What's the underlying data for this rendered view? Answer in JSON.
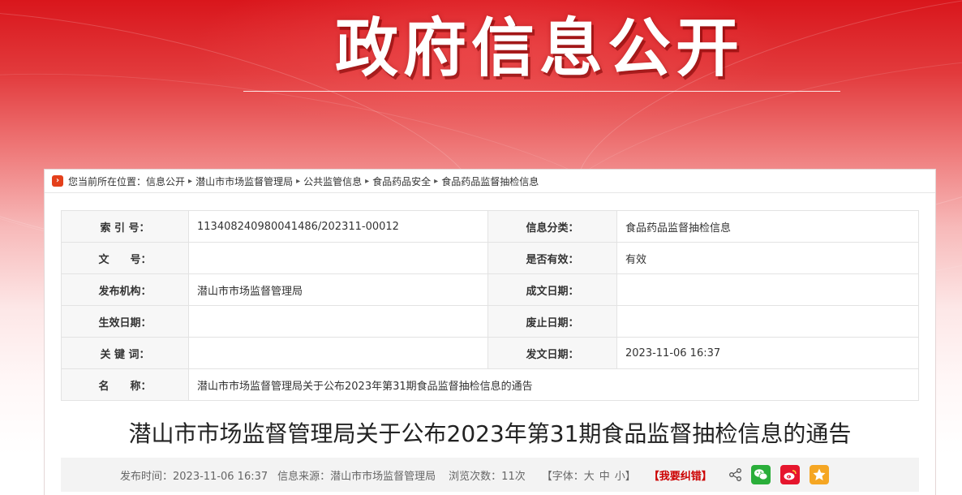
{
  "banner": {
    "title": "政府信息公开"
  },
  "breadcrumb": {
    "icon": "chevron-right-icon",
    "prefix": "您当前所在位置：",
    "items": [
      "信息公开",
      "潜山市市场监督管理局",
      "公共监管信息",
      "食品药品安全",
      "食品药品监督抽检信息"
    ],
    "separator": "▸"
  },
  "info_table": {
    "rows": [
      {
        "label1": "索 引 号：",
        "value1": "113408240980041486/202311-00012",
        "label2": "信息分类：",
        "value2": "食品药品监督抽检信息"
      },
      {
        "label1": "文　　号：",
        "value1": "",
        "label2": "是否有效：",
        "value2": "有效"
      },
      {
        "label1": "发布机构：",
        "value1": "潜山市市场监督管理局",
        "label2": "成文日期：",
        "value2": ""
      },
      {
        "label1": "生效日期：",
        "value1": "",
        "label2": "废止日期：",
        "value2": ""
      },
      {
        "label1": "关 键 词：",
        "value1": "",
        "label2": "发文日期：",
        "value2": "2023-11-06 16:37"
      }
    ],
    "name_row": {
      "label": "名　　称：",
      "value": "潜山市市场监督管理局关于公布2023年第31期食品监督抽检信息的通告"
    }
  },
  "article": {
    "title": "潜山市市场监督管理局关于公布2023年第31期食品监督抽检信息的通告"
  },
  "meta": {
    "publish_time": "发布时间：2023-11-06 16:37",
    "source": "信息来源：潜山市市场监督管理局",
    "views": "浏览次数：11次",
    "font_open": "【字体：",
    "font_large": "大",
    "font_medium": "中",
    "font_small": "小",
    "font_close": "】",
    "correction": "【我要纠错】",
    "share_icon": "share-icon",
    "social": [
      "wechat-icon",
      "weibo-icon",
      "qzone-icon"
    ]
  },
  "colors": {
    "banner_red": "#d9161c",
    "breadcrumb_icon": "#e4401b",
    "correction_red": "#cc0000",
    "wechat": "#2aae3a",
    "weibo": "#e6162d",
    "qzone": "#f5a623"
  }
}
